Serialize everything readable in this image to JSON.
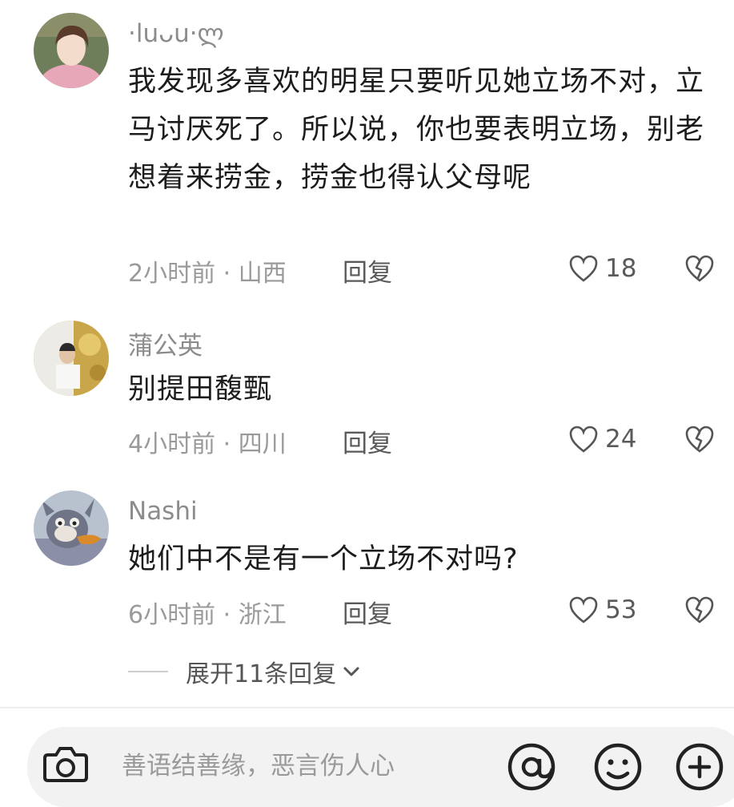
{
  "comments": [
    {
      "username": "·luᴗu·ლ",
      "text": "我发现多喜欢的明星只要听见她立场不对，立马讨厌死了。所以说，你也要表明立场，别老想着来捞金，捞金也得认父母呢",
      "time": "2小时前",
      "location": "山西",
      "reply": "回复",
      "likes": "18",
      "avatar": "girl-pink-hoodie"
    },
    {
      "username": "蒲公英",
      "text": "别提田馥甄",
      "time": "4小时前",
      "location": "四川",
      "reply": "回复",
      "likes": "24",
      "avatar": "person-gold-background"
    },
    {
      "username": "Nashi",
      "text": "她们中不是有一个立场不对吗?",
      "time": "6小时前",
      "location": "浙江",
      "reply": "回复",
      "likes": "53",
      "avatar": "cartoon-cat"
    }
  ],
  "expand_replies": "展开11条回复",
  "input": {
    "placeholder": "善语结善缘，恶言伤人心"
  },
  "icons": [
    "heart-icon",
    "broken-heart-icon",
    "chevron-down-icon",
    "camera-icon",
    "at-icon",
    "emoji-icon",
    "plus-icon"
  ]
}
